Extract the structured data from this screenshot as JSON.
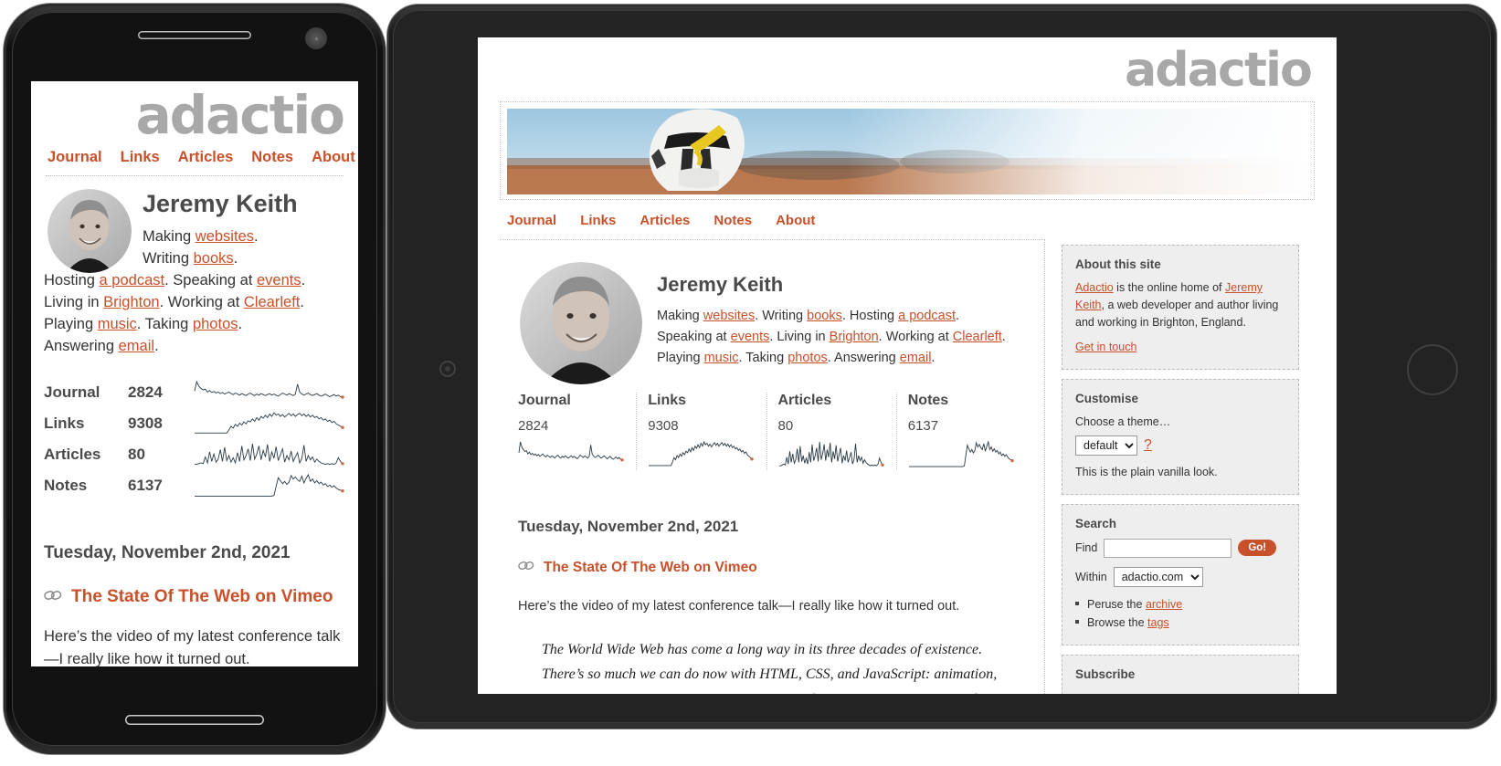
{
  "site": {
    "logo": "adactio",
    "nav": [
      "Journal",
      "Links",
      "Articles",
      "Notes",
      "About"
    ],
    "accent_color": "#c8502a",
    "logo_color": "#a8a8a8"
  },
  "profile": {
    "name": "Jeremy Keith",
    "bio_segments": [
      {
        "text": "Making ",
        "link": false
      },
      {
        "text": "websites",
        "link": true
      },
      {
        "text": ". Writing ",
        "link": false
      },
      {
        "text": "books",
        "link": true
      },
      {
        "text": ". Hosting ",
        "link": false
      },
      {
        "text": "a podcast",
        "link": true
      },
      {
        "text": ". Speaking at ",
        "link": false
      },
      {
        "text": "events",
        "link": true
      },
      {
        "text": ". Living in ",
        "link": false
      },
      {
        "text": "Brighton",
        "link": true
      },
      {
        "text": ". Working at ",
        "link": false
      },
      {
        "text": "Clearleft",
        "link": true
      },
      {
        "text": ". Playing ",
        "link": false
      },
      {
        "text": "music",
        "link": true
      },
      {
        "text": ". Taking ",
        "link": false
      },
      {
        "text": "photos",
        "link": true
      },
      {
        "text": ". Answering ",
        "link": false
      },
      {
        "text": "email",
        "link": true
      },
      {
        "text": ".",
        "link": false
      }
    ],
    "bio_phone_lines": [
      "Making websites.",
      "Writing books.",
      "Hosting a podcast. Speaking at events.",
      "Living in Brighton. Working at Clearleft.",
      "Playing music. Taking photos.",
      "Answering email."
    ],
    "bio_tablet_lines": [
      "Making websites. Writing books. Hosting a podcast.",
      "Speaking at events. Living in Brighton. Working at Clearleft.",
      "Playing music. Taking photos. Answering email."
    ]
  },
  "stats": [
    {
      "name": "Journal",
      "value": "2824"
    },
    {
      "name": "Links",
      "value": "9308"
    },
    {
      "name": "Articles",
      "value": "80"
    },
    {
      "name": "Notes",
      "value": "6137"
    }
  ],
  "post": {
    "date": "Tuesday, November 2nd, 2021",
    "title": "The State Of The Web on Vimeo",
    "permalink_icon": "link-icon",
    "intro_phone": "Here’s the video of my latest conference talk—I really like how it turned out.",
    "intro_tablet": "Here’s the video of my latest conference talk—I really like how it turned out.",
    "quote": "The World Wide Web has come a long way in its three decades of existence. There’s so much we can do now with HTML, CSS, and JavaScript: animation, layout, powerful APIs… we can even make websites that work offline! And yet"
  },
  "sidebar": {
    "about": {
      "title": "About this site",
      "line1_link": "Adactio",
      "line1_mid": " is the online home of ",
      "line1_link2": "Jeremy Keith",
      "line1_rest": ", a web developer and author living and working in Brighton, England.",
      "contact_link": "Get in touch"
    },
    "customise": {
      "title": "Customise",
      "label": "Choose a theme…",
      "selected_theme": "default",
      "help": "?",
      "description": "This is the plain vanilla look."
    },
    "search": {
      "title": "Search",
      "find_label": "Find",
      "find_value": "",
      "find_placeholder": "",
      "go_label": "Go!",
      "within_label": "Within",
      "within_value": "adactio.com",
      "links": [
        {
          "prefix": "Peruse the ",
          "link": "archive"
        },
        {
          "prefix": "Browse the ",
          "link": "tags"
        }
      ]
    },
    "subscribe": {
      "title": "Subscribe"
    }
  },
  "chart_data": [
    {
      "type": "line",
      "title": "Journal",
      "ylabel": "",
      "values": [
        52,
        88,
        70,
        62,
        56,
        59,
        48,
        54,
        46,
        50,
        44,
        48,
        42,
        46,
        40,
        44,
        48,
        42,
        38,
        44,
        40,
        36,
        42,
        38,
        34,
        40,
        44,
        38,
        34,
        40,
        36,
        42,
        38,
        34,
        38,
        42,
        36,
        40,
        36,
        32,
        38,
        44,
        40,
        36,
        42,
        38,
        34,
        40,
        78,
        48,
        40,
        36,
        40,
        44,
        38,
        34,
        38,
        42,
        36,
        32,
        36,
        40,
        34,
        30,
        34,
        38,
        32,
        36,
        30,
        28
      ]
    },
    {
      "type": "line",
      "title": "Links",
      "ylabel": "",
      "values": [
        8,
        8,
        8,
        8,
        8,
        8,
        8,
        8,
        8,
        8,
        8,
        8,
        8,
        8,
        8,
        8,
        18,
        30,
        24,
        36,
        30,
        40,
        34,
        44,
        38,
        48,
        44,
        54,
        46,
        58,
        50,
        62,
        56,
        66,
        58,
        70,
        62,
        74,
        66,
        70,
        62,
        68,
        60,
        66,
        72,
        64,
        70,
        62,
        68,
        72,
        64,
        70,
        62,
        68,
        60,
        66,
        58,
        62,
        54,
        58,
        50,
        54,
        46,
        50,
        42,
        46,
        38,
        34,
        30,
        26
      ]
    },
    {
      "type": "line",
      "title": "Articles",
      "ylabel": "",
      "values": [
        6,
        6,
        8,
        10,
        8,
        26,
        10,
        40,
        14,
        34,
        12,
        20,
        46,
        14,
        52,
        16,
        30,
        12,
        24,
        10,
        38,
        14,
        56,
        18,
        30,
        48,
        16,
        62,
        20,
        34,
        56,
        18,
        44,
        26,
        60,
        14,
        40,
        22,
        54,
        16,
        32,
        48,
        12,
        30,
        18,
        42,
        14,
        26,
        38,
        10,
        22,
        58,
        14,
        30,
        18,
        26,
        12,
        20,
        14,
        10,
        8,
        6,
        8,
        6,
        8,
        6,
        10,
        24,
        14,
        8
      ]
    },
    {
      "type": "line",
      "title": "Notes",
      "ylabel": "",
      "values": [
        4,
        4,
        4,
        4,
        4,
        4,
        4,
        4,
        4,
        4,
        4,
        4,
        4,
        4,
        4,
        4,
        4,
        4,
        4,
        4,
        4,
        4,
        4,
        4,
        4,
        4,
        4,
        4,
        4,
        4,
        4,
        4,
        4,
        4,
        4,
        4,
        4,
        6,
        30,
        54,
        46,
        38,
        44,
        36,
        42,
        60,
        50,
        56,
        48,
        44,
        58,
        40,
        52,
        62,
        44,
        50,
        40,
        46,
        38,
        42,
        34,
        38,
        30,
        34,
        28,
        32,
        26,
        22,
        20,
        18
      ]
    }
  ]
}
